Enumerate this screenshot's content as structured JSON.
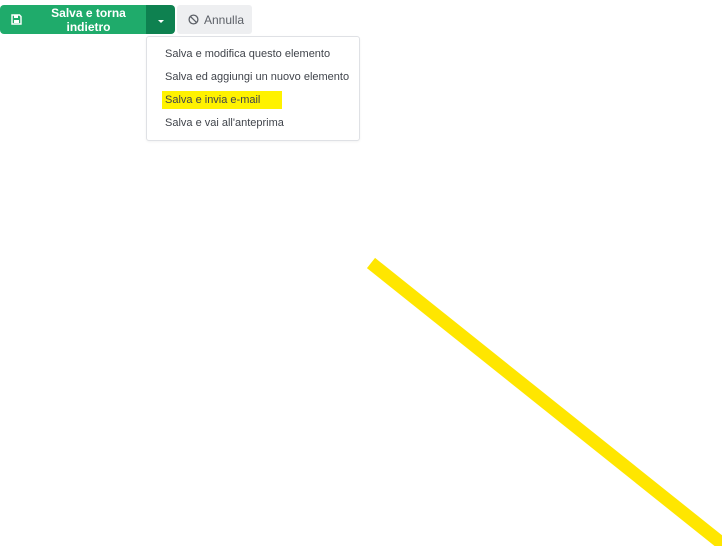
{
  "toolbar": {
    "save_label": "Salva e torna indietro",
    "save_icon": "floppy-disk-icon",
    "toggle_icon": "caret-down-icon",
    "cancel_label": "Annulla",
    "cancel_icon": "ban-icon"
  },
  "dropdown": {
    "items": [
      {
        "label": "Salva e modifica questo elemento"
      },
      {
        "label": "Salva ed aggiungi un nuovo elemento"
      },
      {
        "label": "Salva e invia e-mail",
        "highlighted": true
      },
      {
        "label": "Salva e vai all'anteprima"
      }
    ]
  },
  "colors": {
    "save_button": "#1fab6b",
    "toggle_button": "#0e8150",
    "cancel_button": "#eeeff1",
    "highlight": "#fff200",
    "annotation": "#ffe600"
  }
}
